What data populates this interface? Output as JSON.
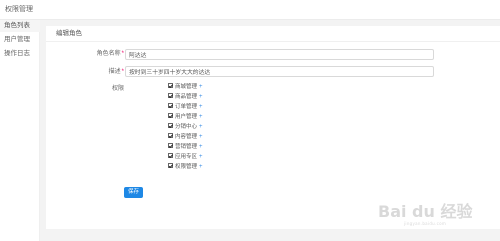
{
  "header": {
    "title": "权限管理"
  },
  "sidebar": {
    "items": [
      {
        "label": "角色列表",
        "active": true
      },
      {
        "label": "用户管理",
        "active": false
      },
      {
        "label": "操作日志",
        "active": false
      }
    ]
  },
  "card": {
    "title": "编辑角色"
  },
  "form": {
    "name_label": "角色名称",
    "name_value": "阿达达",
    "name_required": "*",
    "desc_label": "描述",
    "desc_value": "按时到三十岁四十岁大大的达达",
    "desc_required": "*",
    "perm_label": "权限",
    "permissions": [
      "商城管理",
      "商品管理",
      "订单管理",
      "用户管理",
      "分销中心",
      "内容管理",
      "营销管理",
      "应用专区",
      "权限管理"
    ],
    "expand_glyph": "+",
    "save_label": "保存"
  },
  "watermark": {
    "main": "Bai du 经验",
    "sub": "jingyan.baidu.com"
  },
  "colors": {
    "accent": "#1e88e5",
    "background": "#f3f3f3",
    "required": "#e06"
  }
}
